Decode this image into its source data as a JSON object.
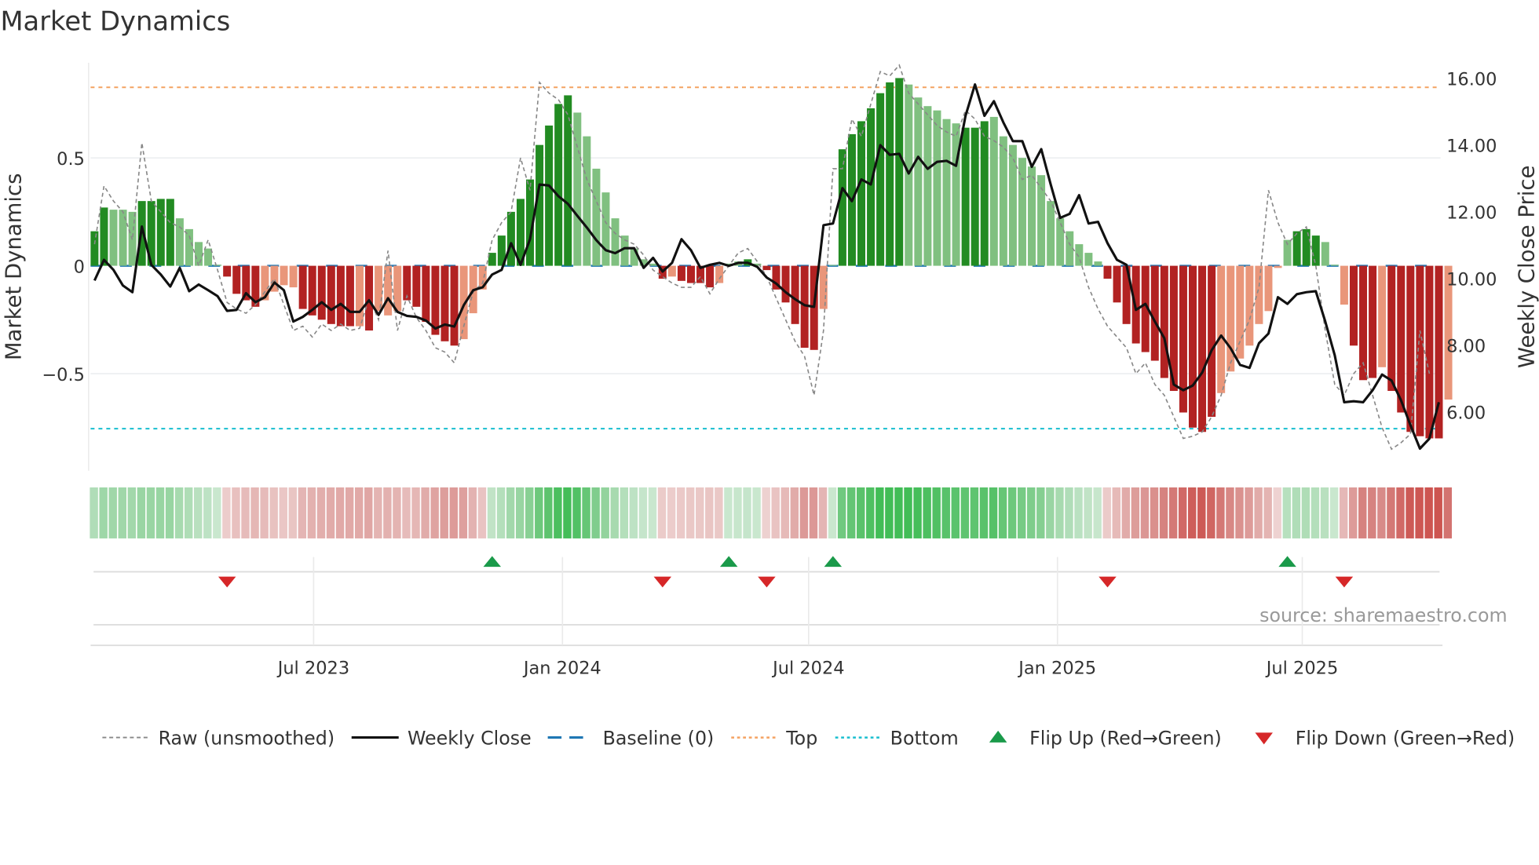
{
  "chart_data": {
    "type": "bar",
    "title": "Market Dynamics",
    "ylabel": "Market Dynamics",
    "y2label": "Weekly Close Price",
    "ylim": [
      -0.95,
      0.95
    ],
    "y2lim": [
      4.5,
      16.5
    ],
    "yticks": [
      {
        "v": 0.5,
        "label": "0.5"
      },
      {
        "v": 0,
        "label": "0"
      },
      {
        "v": -0.5,
        "label": "−0.5"
      }
    ],
    "y2ticks": [
      {
        "v": 16,
        "label": "16.00"
      },
      {
        "v": 14,
        "label": "14.00"
      },
      {
        "v": 12,
        "label": "12.00"
      },
      {
        "v": 10,
        "label": "10.00"
      },
      {
        "v": 8,
        "label": "8.00"
      },
      {
        "v": 6,
        "label": "6.00"
      }
    ],
    "first_week": "2023-01-20",
    "xticks": [
      {
        "date": "2023-07-01",
        "label": "Jul 2023"
      },
      {
        "date": "2024-01-01",
        "label": "Jan 2024"
      },
      {
        "date": "2024-07-01",
        "label": "Jul 2024"
      },
      {
        "date": "2025-01-01",
        "label": "Jan 2025"
      },
      {
        "date": "2025-07-01",
        "label": "Jul 2025"
      }
    ],
    "top": 0.827,
    "bottom": -0.755,
    "baseline": 0,
    "baseline_price": 10.38,
    "market_dynamics": [
      0.16,
      0.27,
      0.26,
      0.26,
      0.25,
      0.3,
      0.3,
      0.31,
      0.31,
      0.22,
      0.17,
      0.11,
      0.08,
      0.005,
      -0.05,
      -0.13,
      -0.16,
      -0.19,
      -0.16,
      -0.12,
      -0.09,
      -0.1,
      -0.2,
      -0.23,
      -0.25,
      -0.27,
      -0.28,
      -0.28,
      -0.28,
      -0.3,
      -0.21,
      -0.23,
      -0.21,
      -0.16,
      -0.19,
      -0.26,
      -0.32,
      -0.35,
      -0.37,
      -0.34,
      -0.22,
      -0.11,
      0.06,
      0.14,
      0.25,
      0.31,
      0.4,
      0.56,
      0.65,
      0.75,
      0.79,
      0.71,
      0.6,
      0.45,
      0.34,
      0.22,
      0.14,
      0.08,
      0.03,
      0.01,
      -0.06,
      -0.05,
      -0.07,
      -0.08,
      -0.08,
      -0.1,
      -0.08,
      0.01,
      0.02,
      0.03,
      0.01,
      -0.02,
      -0.11,
      -0.17,
      -0.27,
      -0.38,
      -0.39,
      -0.2,
      0.004,
      0.54,
      0.61,
      0.67,
      0.73,
      0.8,
      0.85,
      0.87,
      0.84,
      0.78,
      0.74,
      0.72,
      0.68,
      0.66,
      0.64,
      0.64,
      0.67,
      0.69,
      0.6,
      0.56,
      0.5,
      0.46,
      0.42,
      0.3,
      0.22,
      0.16,
      0.1,
      0.06,
      0.02,
      -0.06,
      -0.17,
      -0.27,
      -0.36,
      -0.4,
      -0.44,
      -0.52,
      -0.58,
      -0.68,
      -0.75,
      -0.77,
      -0.7,
      -0.59,
      -0.49,
      -0.43,
      -0.37,
      -0.27,
      -0.21,
      -0.01,
      0.12,
      0.16,
      0.17,
      0.14,
      0.11,
      0.005,
      -0.18,
      -0.37,
      -0.53,
      -0.52,
      -0.47,
      -0.58,
      -0.68,
      -0.77,
      -0.79,
      -0.8,
      -0.8,
      -0.62
    ],
    "shade": "DDLLLDDDDLLLLLDDDDLLLLDDDDDDLDLLLDDDDDDLLLDDDDDDDDDLLLLLLLLLDLDDDDLLLDLDDDDDDLLDDDDDDDLLLLLLDDDLLLLLLLLLLLLDDDDDDDDDDDDLLLLLLLLDDDLLLDDDLDDDDDDL",
    "raw": [
      0.1,
      0.37,
      0.3,
      0.25,
      0.12,
      0.57,
      0.3,
      0.25,
      0.2,
      0.18,
      0.14,
      0.0,
      0.12,
      -0.02,
      -0.17,
      -0.2,
      -0.22,
      -0.18,
      -0.12,
      -0.06,
      -0.18,
      -0.3,
      -0.28,
      -0.33,
      -0.27,
      -0.3,
      -0.27,
      -0.3,
      -0.29,
      -0.15,
      -0.25,
      0.07,
      -0.3,
      -0.14,
      -0.24,
      -0.3,
      -0.38,
      -0.4,
      -0.45,
      -0.28,
      -0.12,
      -0.08,
      0.12,
      0.2,
      0.25,
      0.5,
      0.35,
      0.85,
      0.8,
      0.77,
      0.7,
      0.55,
      0.4,
      0.3,
      0.2,
      0.15,
      0.12,
      0.1,
      0.05,
      -0.02,
      -0.05,
      -0.08,
      -0.1,
      -0.1,
      -0.05,
      -0.13,
      -0.06,
      0.0,
      0.06,
      0.08,
      0.02,
      -0.05,
      -0.15,
      -0.25,
      -0.35,
      -0.42,
      -0.6,
      -0.3,
      0.45,
      0.45,
      0.68,
      0.6,
      0.75,
      0.9,
      0.88,
      0.93,
      0.8,
      0.75,
      0.7,
      0.65,
      0.62,
      0.6,
      0.72,
      0.68,
      0.6,
      0.58,
      0.55,
      0.5,
      0.4,
      0.42,
      0.36,
      0.3,
      0.2,
      0.1,
      0.04,
      -0.1,
      -0.2,
      -0.28,
      -0.33,
      -0.38,
      -0.5,
      -0.45,
      -0.55,
      -0.6,
      -0.7,
      -0.8,
      -0.79,
      -0.77,
      -0.7,
      -0.6,
      -0.45,
      -0.35,
      -0.25,
      -0.1,
      0.35,
      0.2,
      0.1,
      0.15,
      0.18,
      0.0,
      -0.3,
      -0.55,
      -0.6,
      -0.5,
      -0.45,
      -0.6,
      -0.75,
      -0.85,
      -0.82,
      -0.78,
      -0.3,
      -0.5
    ],
    "weekly_close": [
      9.94,
      10.56,
      10.26,
      9.79,
      9.59,
      11.56,
      10.41,
      10.12,
      9.76,
      10.32,
      9.62,
      9.82,
      9.65,
      9.47,
      9.03,
      9.06,
      9.56,
      9.29,
      9.44,
      9.88,
      9.65,
      8.71,
      8.85,
      9.06,
      9.29,
      9.06,
      9.24,
      9.0,
      9.0,
      9.35,
      8.91,
      9.41,
      9.0,
      8.88,
      8.85,
      8.74,
      8.5,
      8.62,
      8.56,
      9.2,
      9.65,
      9.74,
      10.12,
      10.26,
      11.06,
      10.41,
      11.18,
      12.82,
      12.79,
      12.47,
      12.24,
      11.88,
      11.53,
      11.15,
      10.85,
      10.76,
      10.91,
      10.91,
      10.32,
      10.62,
      10.21,
      10.47,
      11.18,
      10.85,
      10.32,
      10.41,
      10.47,
      10.38,
      10.47,
      10.47,
      10.35,
      10.03,
      9.85,
      9.59,
      9.38,
      9.2,
      9.15,
      11.6,
      11.65,
      12.71,
      12.32,
      12.97,
      12.82,
      14.0,
      13.71,
      13.74,
      13.15,
      13.65,
      13.29,
      13.5,
      13.53,
      13.38,
      14.88,
      15.82,
      14.88,
      15.32,
      14.68,
      14.12,
      14.12,
      13.35,
      13.88,
      12.82,
      11.82,
      11.94,
      12.5,
      11.65,
      11.7,
      11.06,
      10.56,
      10.41,
      9.06,
      9.24,
      8.71,
      8.21,
      6.82,
      6.65,
      6.79,
      7.18,
      7.85,
      8.29,
      7.91,
      7.41,
      7.32,
      8.06,
      8.35,
      9.44,
      9.24,
      9.53,
      9.59,
      9.62,
      8.71,
      7.7,
      6.29,
      6.32,
      6.29,
      6.65,
      7.12,
      6.94,
      6.35,
      5.6,
      4.9,
      5.2,
      6.29
    ],
    "flip_up_weeks": [
      42,
      67,
      78,
      126
    ],
    "flip_down_weeks": [
      14,
      60,
      71,
      107,
      132
    ],
    "legend": {
      "raw": "Raw (unsmoothed)",
      "close": "Weekly Close",
      "baseline": "Baseline (0)",
      "top": "Top",
      "bottom": "Bottom",
      "flip_up": "Flip Up (Red→Green)",
      "flip_down": "Flip Down (Green→Red)"
    },
    "colors": {
      "pos_strong": "#228b22",
      "pos_weak": "#80c080",
      "neg_strong": "#b22222",
      "neg_weak": "#e9967a",
      "close": "#111111",
      "raw": "#888888",
      "baseline": "#1f77b4",
      "top": "#f4a261",
      "bottom": "#17becf",
      "flip_up": "#1a9a4a",
      "flip_down": "#d62728"
    }
  },
  "source": "source: sharemaestro.com"
}
